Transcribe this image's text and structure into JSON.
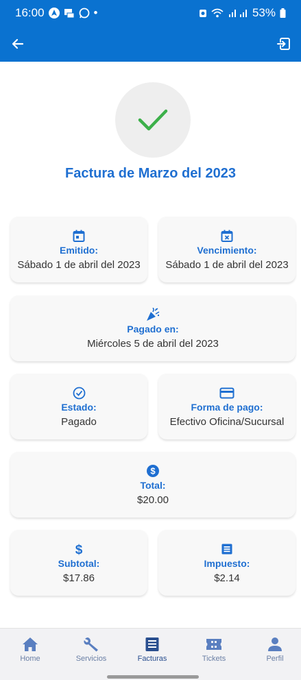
{
  "status_bar": {
    "time": "16:00",
    "dot": "•",
    "battery": "53%"
  },
  "app_bar": {
    "back_icon": "arrow-left-icon",
    "logout_icon": "exit-icon"
  },
  "header": {
    "title": "Factura de Marzo del 2023"
  },
  "cards": {
    "emitido": {
      "label": "Emitido:",
      "value": "Sábado 1 de abril del 2023",
      "icon": "calendar-icon"
    },
    "vencimiento": {
      "label": "Vencimiento:",
      "value": "Sábado 1 de abril del 2023",
      "icon": "calendar-x-icon"
    },
    "pagado_en": {
      "label": "Pagado en:",
      "value": "Miércoles 5 de abril del 2023",
      "icon": "party-popper-icon"
    },
    "estado": {
      "label": "Estado:",
      "value": "Pagado",
      "icon": "check-circle-icon"
    },
    "forma_pago": {
      "label": "Forma de pago:",
      "value": "Efectivo Oficina/Sucursal",
      "icon": "credit-card-icon"
    },
    "total": {
      "label": "Total:",
      "value": "$20.00",
      "icon": "dollar-circle-icon"
    },
    "subtotal": {
      "label": "Subtotal:",
      "value": "$17.86",
      "icon": "dollar-icon"
    },
    "impuesto": {
      "label": "Impuesto:",
      "value": "$2.14",
      "icon": "receipt-icon"
    }
  },
  "bottom_nav": {
    "items": [
      {
        "label": "Home",
        "icon": "home-icon"
      },
      {
        "label": "Servicios",
        "icon": "wrench-icon"
      },
      {
        "label": "Facturas",
        "icon": "invoice-icon",
        "active": true
      },
      {
        "label": "Tickets",
        "icon": "ticket-icon"
      },
      {
        "label": "Perfil",
        "icon": "person-icon"
      }
    ]
  },
  "colors": {
    "primary": "#0a72d0",
    "accent_text": "#1f6fd1",
    "success": "#3cb04a",
    "nav_active": "#2a4f8f",
    "nav_inactive": "#6a7fa5"
  }
}
